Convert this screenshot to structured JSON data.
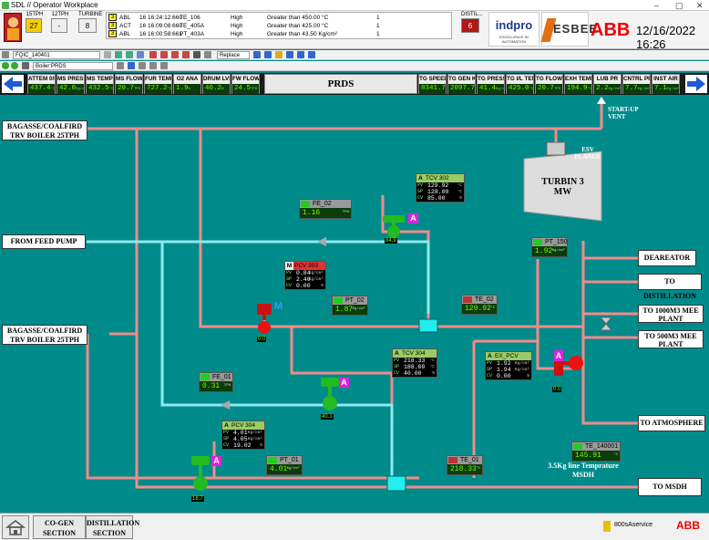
{
  "window": {
    "title": "SDL // Operator Workplace",
    "minimize": "–",
    "maximize": "▢",
    "close": "✕"
  },
  "header": {
    "counters": [
      {
        "label": "15TPH",
        "value": "27"
      },
      {
        "label": "12TPH",
        "value": "-"
      },
      {
        "label": "TURBINE",
        "value": "8"
      }
    ],
    "alarms": [
      {
        "sev": "3",
        "state": "ABL",
        "time": "16 16:24:12:660",
        "tag": "TE_106",
        "priority": "High",
        "desc": "Greater than 450.00 °C",
        "count": "1"
      },
      {
        "sev": "3",
        "state": "ACT",
        "time": "16 16:09:08:660",
        "tag": "TE_405A",
        "priority": "High",
        "desc": "Greater than 425.00 °C",
        "count": "1"
      },
      {
        "sev": "3",
        "state": "ABL",
        "time": "16 16:00:58:661",
        "tag": "PT_403A",
        "priority": "High",
        "desc": "Greater than 43.50 Kg/cm²",
        "count": "1"
      }
    ],
    "distil_label": "DISTIL...",
    "distil_value": "6",
    "logo_indpro": "indpro",
    "logo_indpro_sub": "EXCELLENCE IN AUTOMATION",
    "logo_esbee": "ESBEE",
    "logo_abb": "ABB",
    "datetime": "12/16/2022 16:26"
  },
  "toolbar1": {
    "display": "FQIC_140401",
    "replace": "Replace"
  },
  "toolbar2": {
    "path": "Boiler:PRDS"
  },
  "valstrip": {
    "title": "PRDS",
    "left": [
      {
        "label": "ATTEM 0/L",
        "value": "437.4",
        "unit": "°C"
      },
      {
        "label": "MS PRESS",
        "value": "42.0",
        "unit": "Kg/cm²"
      },
      {
        "label": "MS TEMP",
        "value": "432.5",
        "unit": "°C"
      },
      {
        "label": "MS FLOW",
        "value": "20.7",
        "unit": "TPH"
      },
      {
        "label": "FUR TEMP",
        "value": "727.2",
        "unit": "°C"
      },
      {
        "label": "O2 ANA",
        "value": "1.9",
        "unit": "%"
      },
      {
        "label": "DRUM LVL",
        "value": "46.2",
        "unit": "%"
      },
      {
        "label": "FW FLOW",
        "value": "24.5",
        "unit": "TPH"
      }
    ],
    "right": [
      {
        "label": "TG SPEED",
        "value": "8341.7",
        "unit": "RPM"
      },
      {
        "label": "TG GEN KW",
        "value": "2097.7",
        "unit": "KW"
      },
      {
        "label": "TG PRESS",
        "value": "41.4",
        "unit": "Kg/cm²"
      },
      {
        "label": "TG I/L TEM",
        "value": "425.0",
        "unit": "°C"
      },
      {
        "label": "TG FLOW",
        "value": "20.7",
        "unit": "TPH"
      },
      {
        "label": "EXH TEMP",
        "value": "194.9",
        "unit": "°C"
      },
      {
        "label": "LUB PR",
        "value": "2.2",
        "unit": "Kg/cm²"
      },
      {
        "label": "CNTRL PR",
        "value": "7.7",
        "unit": "Kg/cm²"
      },
      {
        "label": "INST AIR",
        "value": "7.1",
        "unit": "Kg/cm²"
      }
    ]
  },
  "hmi": {
    "source1": "BAGASSE/COALFIRD TRV BOILER 25TPH",
    "source2": "BAGASSE/COALFIRD TRV BOILER 25TPH",
    "feed": "FROM FEED PUMP",
    "startup_vent": "START-UP VENT",
    "esv_flange": "ESV FLANGE",
    "turbine": "TURBIN 3 MW",
    "outputs": [
      "DEAREATOR",
      "TO DISTILLATION",
      "TO 1000M3 MEE PLANT",
      "TO 500M3 MEE PLANT",
      "TO ATMOSPHERE",
      "TO MSDH"
    ],
    "msdh_note": "3.5Kg line Temprature MSDH",
    "tags": {
      "fe02": {
        "name": "FE_02",
        "value": "1.16",
        "unit": "TPH"
      },
      "pt150": {
        "name": "PT_150",
        "value": "1.92",
        "unit": "Kg/cm²"
      },
      "pt02": {
        "name": "PT_02",
        "value": "1.87",
        "unit": "Kg/cm²"
      },
      "te02": {
        "name": "TE_02",
        "value": "129.92",
        "unit": "°C"
      },
      "fe01": {
        "name": "FE_01",
        "value": "0.31",
        "unit": "TPH"
      },
      "pt01": {
        "name": "PT_01",
        "value": "4.01",
        "unit": "Kg/cm²"
      },
      "te01": {
        "name": "TE_01",
        "value": "218.33",
        "unit": "°C"
      },
      "te140001": {
        "name": "TE_140001",
        "value": "145.91",
        "unit": "°C"
      }
    },
    "controllers": {
      "tcv302": {
        "mode": "A",
        "name": "TCV 302",
        "pv": "129.92",
        "sp": "128.00",
        "cv": "85.00",
        "u1": "°C",
        "u2": "°C",
        "u3": "%"
      },
      "pcv303": {
        "mode": "M",
        "name": "PCV 303",
        "pv": "0.84",
        "sp": "2.40",
        "cv": "0.00",
        "u1": "Kg/cm²",
        "u2": "Kg/cm²",
        "u3": "%"
      },
      "tcv304": {
        "mode": "A",
        "name": "TCV 304",
        "pv": "218.33",
        "sp": "188.00",
        "cv": "40.00",
        "u1": "°C",
        "u2": "°C",
        "u3": "%"
      },
      "expcv": {
        "mode": "A",
        "name": "EX_PCV",
        "pv": "1.92",
        "sp": "1.94",
        "cv": "0.00",
        "u1": "Kg/cm²",
        "u2": "Kg/cm²",
        "u3": "%"
      },
      "pcv304": {
        "mode": "A",
        "name": "PCV 304",
        "pv": "4.01",
        "sp": "4.05",
        "cv": "19.02",
        "u1": "Kg/cm²",
        "u2": "Kg/cm²",
        "u3": "%"
      }
    },
    "valve_outputs": {
      "v1": "84.9",
      "v2": "0.0",
      "v3": "40.1",
      "v4": "0.0",
      "v5": "18.7"
    },
    "mode_badges": {
      "v1": "A",
      "v2": "M",
      "v3": "A",
      "v4": "A",
      "v5": "A"
    }
  },
  "bottom": {
    "nav1": "CO-GEN SECTION",
    "nav2": "DISTILLATION SECTION",
    "user": "800sAservice",
    "logo": "ABB"
  },
  "colors": {
    "background": "#008b8b",
    "steam_pipe": "#f28b8b",
    "water_pipe": "#8fe8ef",
    "value_green": "#7cfc00",
    "auto_badge": "#e020e0"
  }
}
